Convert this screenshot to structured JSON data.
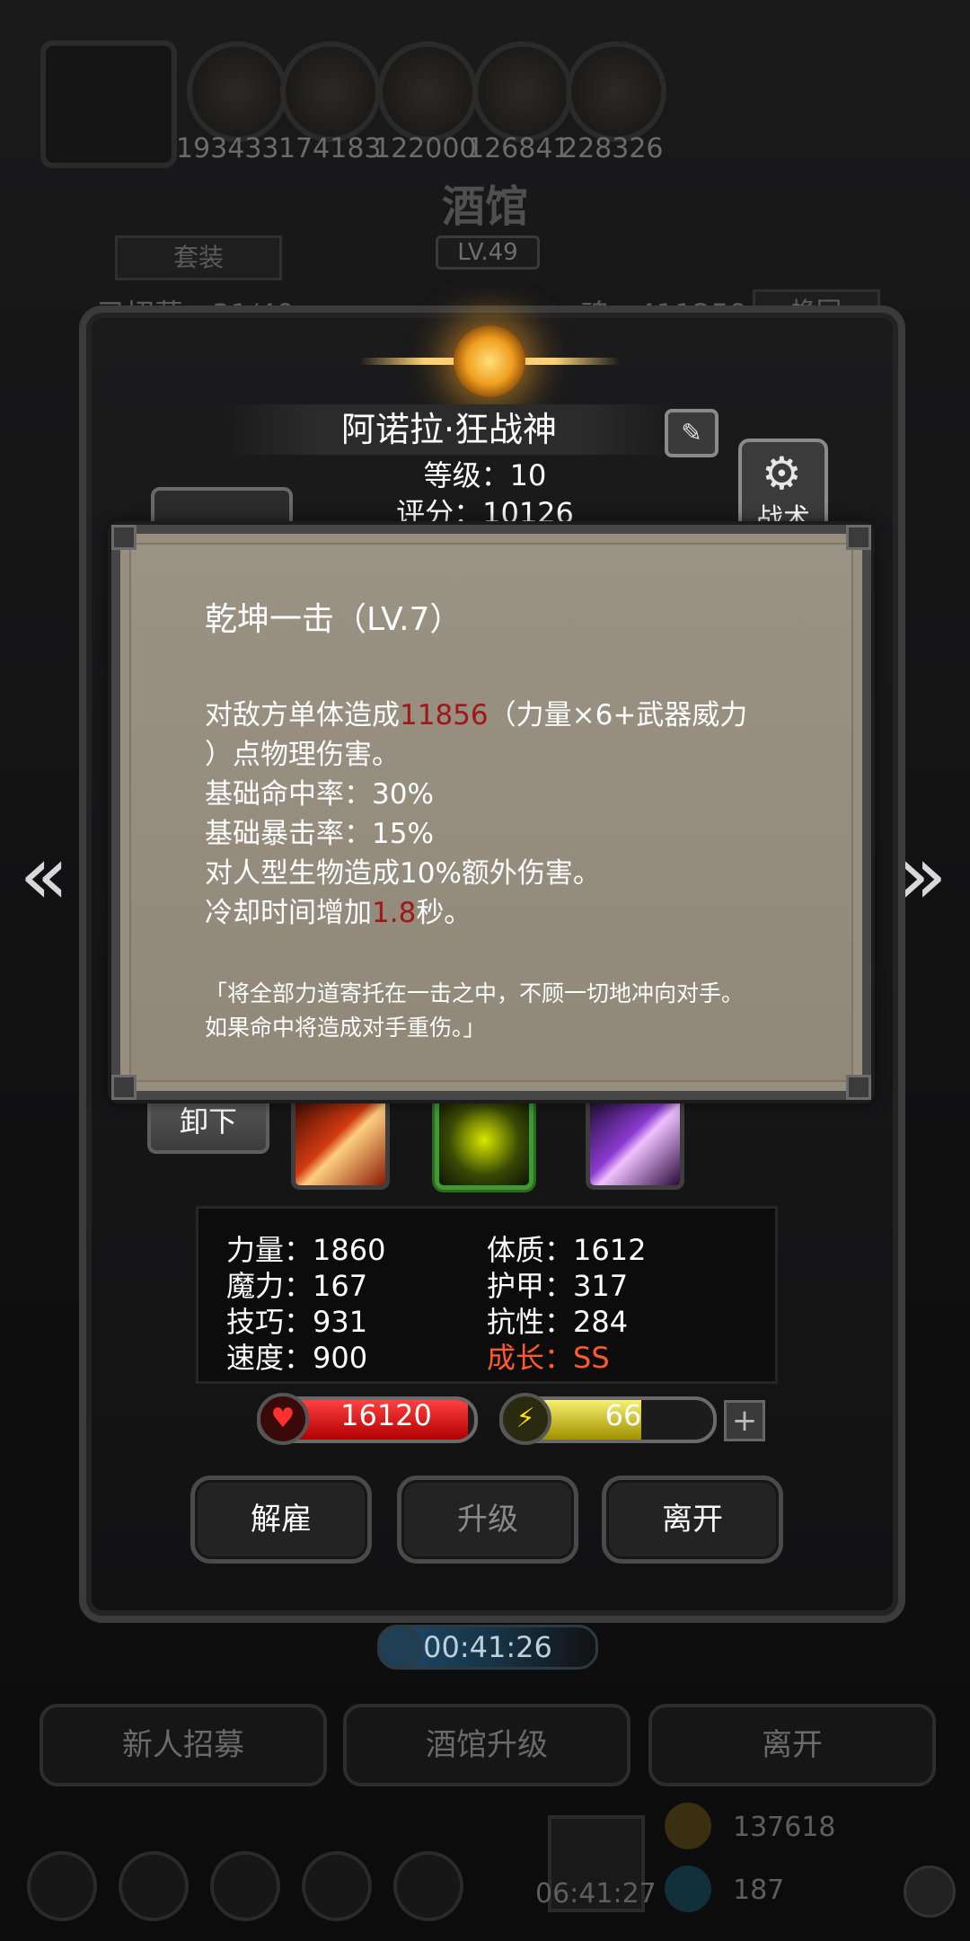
{
  "background": {
    "top_resources": [
      "193433",
      "174183",
      "122000",
      "126841",
      "228326"
    ],
    "screen_title": "酒馆",
    "tavern_level": "LV.49",
    "set_tab": "套装",
    "recruits": "已招募：31/49",
    "soul": "魂：411259",
    "swap_tab": "换回",
    "timer": "00:41:26",
    "bottom_buttons": [
      "新人招募",
      "酒馆升级",
      "离开"
    ],
    "gold": "137618",
    "gems": "187",
    "gift_timer": "06:41:27"
  },
  "hero": {
    "name": "阿诺拉·狂战神",
    "level_line": "等级：10",
    "score_line": "评分：10126",
    "tactics_label": "战术",
    "unequip_label": "卸下",
    "stats": {
      "strength": "力量：1860",
      "magic": "魔力：167",
      "skill": "技巧：931",
      "speed": "速度：900",
      "constitution": "体质：1612",
      "armor": "护甲：317",
      "resistance": "抗性：284",
      "growth": "成长：SS"
    },
    "hp": {
      "value": "16120",
      "fraction": 0.97
    },
    "energy": {
      "value": "66",
      "fraction": 0.66
    },
    "actions": {
      "dismiss": "解雇",
      "upgrade": "升级",
      "leave": "离开"
    }
  },
  "tooltip": {
    "title": "乾坤一击（LV.7）",
    "desc_pre": "对敌方单体造成",
    "desc_value": "11856",
    "desc_post": "（力量×6+武器威力",
    "desc_line2": "）点物理伤害。",
    "hit_rate": "基础命中率：30%",
    "crit_rate": "基础暴击率：15%",
    "bonus": "对人型生物造成10%额外伤害。",
    "cooldown_pre": "冷却时间增加",
    "cooldown_value": "1.8",
    "cooldown_post": "秒。",
    "quote_line1": "「将全部力道寄托在一击之中，不顾一切地冲向对手。",
    "quote_line2": "如果命中将造成对手重伤。」"
  },
  "icons": {
    "left_arrow": "double-chevron-left-icon",
    "right_arrow": "double-chevron-right-icon",
    "edit": "pencil-edit-icon",
    "tactics": "gear-icon",
    "hp": "heart-icon",
    "energy": "lightning-icon"
  },
  "colors": {
    "highlight_red": "#a0171a",
    "growth_orange": "#ff5a2a"
  }
}
